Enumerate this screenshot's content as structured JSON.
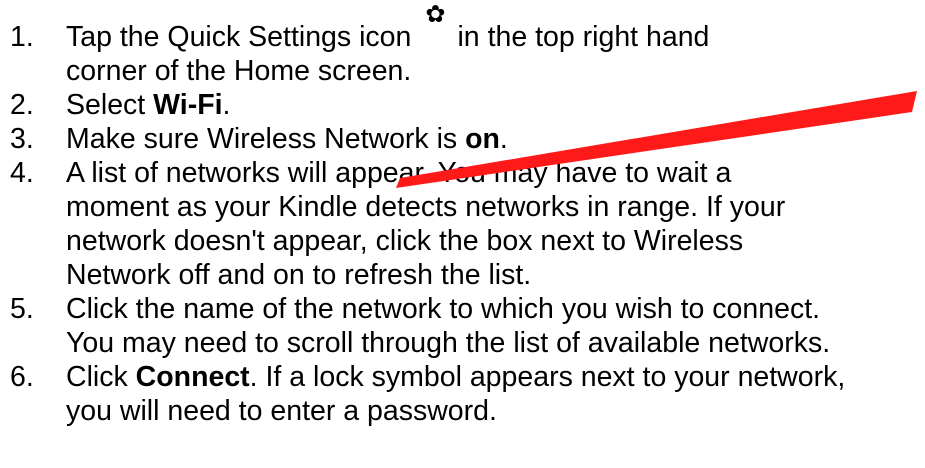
{
  "steps": [
    {
      "number": "1.",
      "before": "Tap the Quick Settings icon",
      "icon": "gear-icon",
      "after": "in the top right hand",
      "line2": "corner of the Home screen."
    },
    {
      "number": "2.",
      "before": "Select ",
      "bold": "Wi-Fi",
      "after": "."
    },
    {
      "number": "3.",
      "before": "Make sure Wireless Network is ",
      "bold": "on",
      "after": "."
    },
    {
      "number": "4.",
      "lines": [
        "A list of networks will appear. You may have to wait a",
        "moment as your Kindle detects networks in range. If your",
        "network doesn't appear, click the box next to Wireless",
        "Network off and on to refresh the list."
      ]
    },
    {
      "number": "5.",
      "lines": [
        "Click the name of the network to which you wish to connect.",
        "You may need to scroll through the list of available networks."
      ]
    },
    {
      "number": "6.",
      "before": "Click ",
      "bold": "Connect",
      "after": ". If a lock symbol appears next to your network,",
      "line2": "you will need to enter a password."
    }
  ],
  "colors": {
    "text": "#000000",
    "pointer": "#ff1a1a"
  }
}
